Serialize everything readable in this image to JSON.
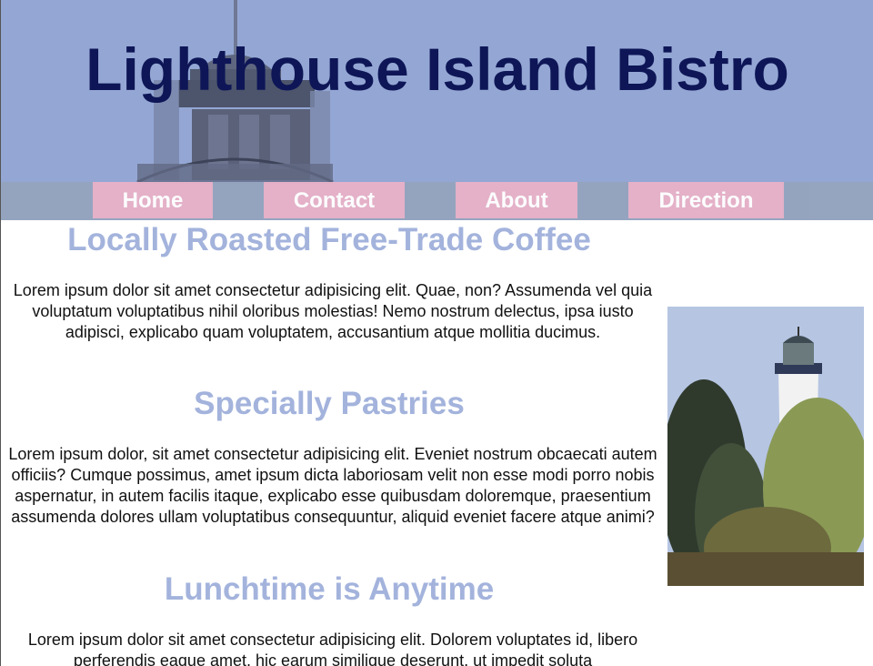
{
  "header": {
    "title": "Lighthouse Island Bistro",
    "background_image": "lighthouse-top"
  },
  "nav": {
    "items": [
      {
        "label": "Home"
      },
      {
        "label": "Contact"
      },
      {
        "label": "About"
      },
      {
        "label": "Direction"
      }
    ],
    "colors": {
      "band": "#95a4bf",
      "button": "#e6b2c8",
      "text": "#ffffff"
    }
  },
  "main": {
    "sections": [
      {
        "heading": "Locally Roasted Free-Trade Coffee",
        "text": "Lorem ipsum dolor sit amet consectetur adipisicing elit. Quae, non? Assumenda vel quia voluptatum voluptatibus nihil oloribus molestias! Nemo nostrum delectus, ipsa iusto adipisci, explicabo quam voluptatem, accusantium atque mollitia ducimus."
      },
      {
        "heading": "Specially Pastries",
        "text": "Lorem ipsum dolor, sit amet consectetur adipisicing elit. Eveniet nostrum obcaecati autem officiis? Cumque possimus, amet ipsum dicta laboriosam velit non esse modi porro nobis aspernatur, in autem facilis itaque, explicabo esse quibusdam doloremque, praesentium assumenda dolores ullam voluptatibus consequuntur, aliquid eveniet facere atque animi?"
      },
      {
        "heading": "Lunchtime is Anytime",
        "text": "Lorem ipsum dolor sit amet consectetur adipisicing elit. Dolorem voluptates id, libero perferendis eaque amet, hic earum similique deserunt, ut impedit soluta"
      }
    ],
    "heading_color": "#a3b3dc"
  },
  "aside": {
    "photo": "lighthouse-photo"
  }
}
